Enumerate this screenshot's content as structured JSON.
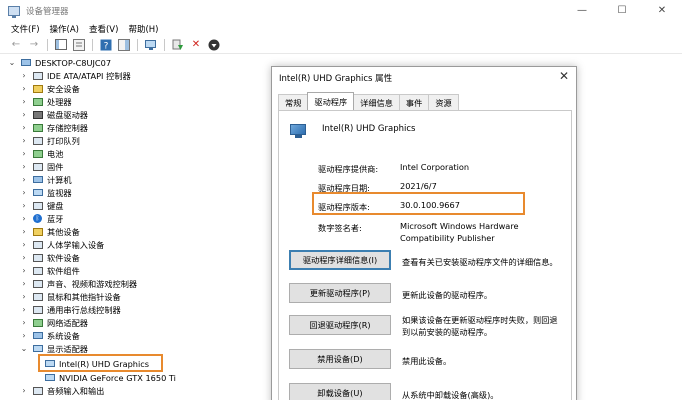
{
  "window": {
    "title": "设备管理器",
    "controls": [
      "—",
      "☐",
      "✕"
    ]
  },
  "menu": [
    "文件(F)",
    "操作(A)",
    "查看(V)",
    "帮助(H)"
  ],
  "tree": {
    "root": "DESKTOP-C8UJC07",
    "categories": [
      "IDE ATA/ATAPI 控制器",
      "安全设备",
      "处理器",
      "磁盘驱动器",
      "存储控制器",
      "打印队列",
      "电池",
      "固件",
      "计算机",
      "监视器",
      "键盘",
      "蓝牙",
      "其他设备",
      "人体学输入设备",
      "软件设备",
      "软件组件",
      "声音、视频和游戏控制器",
      "鼠标和其他指针设备",
      "通用串行总线控制器",
      "网络适配器",
      "系统设备",
      "显示适配器"
    ],
    "display_children": [
      "Intel(R) UHD Graphics",
      "NVIDIA GeForce GTX 1650 Ti"
    ],
    "after": [
      "音频输入和输出"
    ]
  },
  "dialog": {
    "title": "Intel(R) UHD Graphics 属性",
    "close": "✕",
    "tabs": [
      "常规",
      "驱动程序",
      "详细信息",
      "事件",
      "资源"
    ],
    "device_name": "Intel(R) UHD Graphics",
    "fields": {
      "provider_label": "驱动程序提供商:",
      "provider_value": "Intel Corporation",
      "date_label": "驱动程序日期:",
      "date_value": "2021/6/7",
      "version_label": "驱动程序版本:",
      "version_value": "30.0.100.9667",
      "signer_label": "数字签名者:",
      "signer_value": "Microsoft Windows Hardware Compatibility Publisher"
    },
    "buttons": [
      {
        "label": "驱动程序详细信息(I)",
        "desc": "查看有关已安装驱动程序文件的详细信息。"
      },
      {
        "label": "更新驱动程序(P)",
        "desc": "更新此设备的驱动程序。"
      },
      {
        "label": "回退驱动程序(R)",
        "desc": "如果该设备在更新驱动程序时失败，则回退到以前安装的驱动程序。"
      },
      {
        "label": "禁用设备(D)",
        "desc": "禁用此设备。"
      },
      {
        "label": "卸载设备(U)",
        "desc": "从系统中卸载设备(高级)。"
      }
    ]
  }
}
